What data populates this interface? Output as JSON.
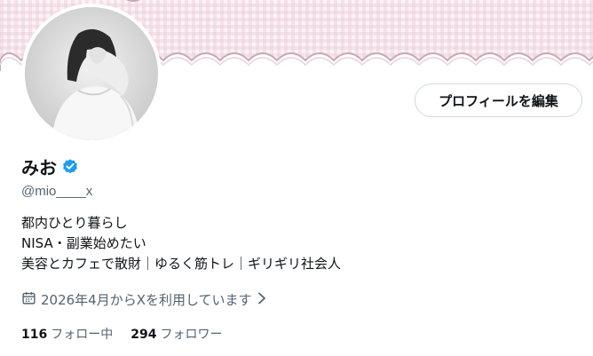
{
  "profile": {
    "display_name": "みお",
    "verified_icon": "verified-badge-icon",
    "handle": "@mio____x",
    "edit_button_label": "プロフィールを編集",
    "bio_lines": [
      "都内ひとり暮らし",
      "NISA・副業始めたい",
      "美容とカフェで散財｜ゆるく筋トレ｜ギリギリ社会人"
    ],
    "joined_text": "2026年4月からXを利用しています",
    "following_count": "116",
    "following_label": "フォロー中",
    "followers_count": "294",
    "followers_label": "フォロワー"
  },
  "colors": {
    "banner_pink": "#fbf3f6",
    "scallop_stroke": "#c9a9b6",
    "verified_blue": "#1d9bf0",
    "secondary_text": "#536471",
    "primary_text": "#0f1419"
  }
}
